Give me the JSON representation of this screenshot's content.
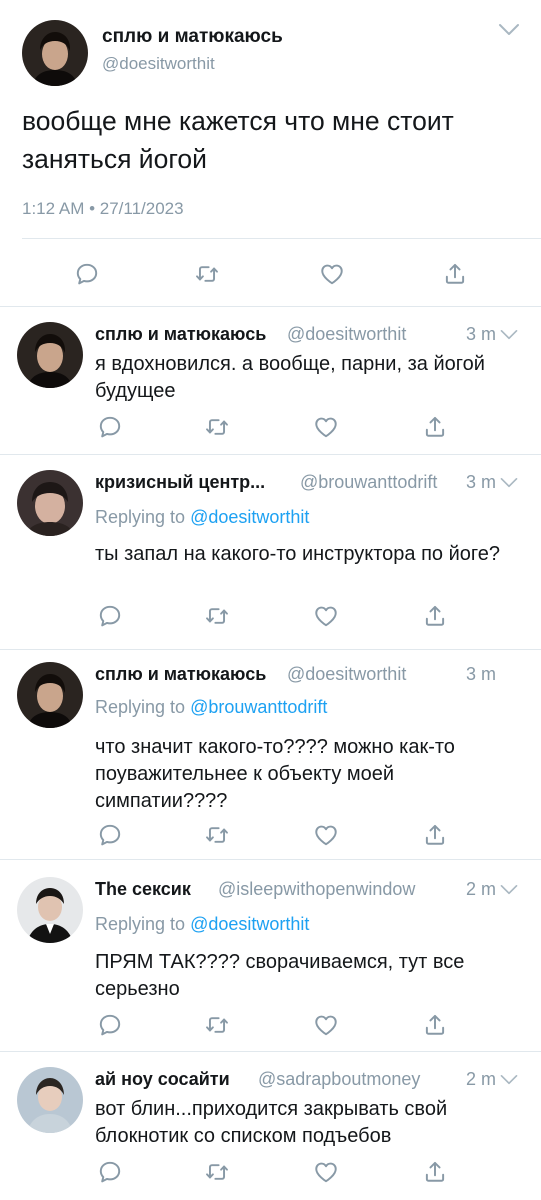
{
  "main_tweet": {
    "author_name": "сплю и матюкаюсь",
    "author_handle": "@doesitworthit",
    "text": "вообще мне кажется что мне стоит заняться йогой",
    "timestamp": "1:12 AM • 27/11/2023"
  },
  "replies": [
    {
      "name": "сплю и матюкаюсь",
      "handle": "@doesitworthit",
      "time": "3 m",
      "replying_to_label": "",
      "replying_to_mention": "",
      "text": "я вдохновился. а вообще, парни, за йогой будущее"
    },
    {
      "name": "кризисный центр...",
      "handle": "@brouwanttodrift",
      "time": "3 m",
      "replying_to_label": "Replying to ",
      "replying_to_mention": "@doesitworthit",
      "text": "ты запал на какого-то инструктора по йоге?"
    },
    {
      "name": "сплю и матюкаюсь",
      "handle": "@doesitworthit",
      "time": "3 m",
      "replying_to_label": "Replying to ",
      "replying_to_mention": "@brouwanttodrift",
      "text": "что значит какого-то???? можно как-то поуважительнее к объекту моей симпатии????"
    },
    {
      "name": "The сексик",
      "handle": "@isleepwithopenwindow",
      "time": "2 m",
      "replying_to_label": "Replying to ",
      "replying_to_mention": "@doesitworthit",
      "text": "ПРЯМ ТАК???? сворачиваемся, тут все серьезно"
    },
    {
      "name": "ай ноу сосайти",
      "handle": "@sadrapboutmoney",
      "time": "2 m",
      "replying_to_label": "",
      "replying_to_mention": "",
      "text": "вот блин...приходится закрывать свой блокнотик со списком подъебов"
    }
  ],
  "icons": {
    "reply": "reply-icon",
    "retweet": "retweet-icon",
    "like": "heart-icon",
    "share": "share-icon",
    "more": "chevron-down-icon"
  },
  "colors": {
    "text": "#14171a",
    "secondary": "#8899a6",
    "link": "#1da1f2",
    "divider": "#e1e8ed"
  }
}
